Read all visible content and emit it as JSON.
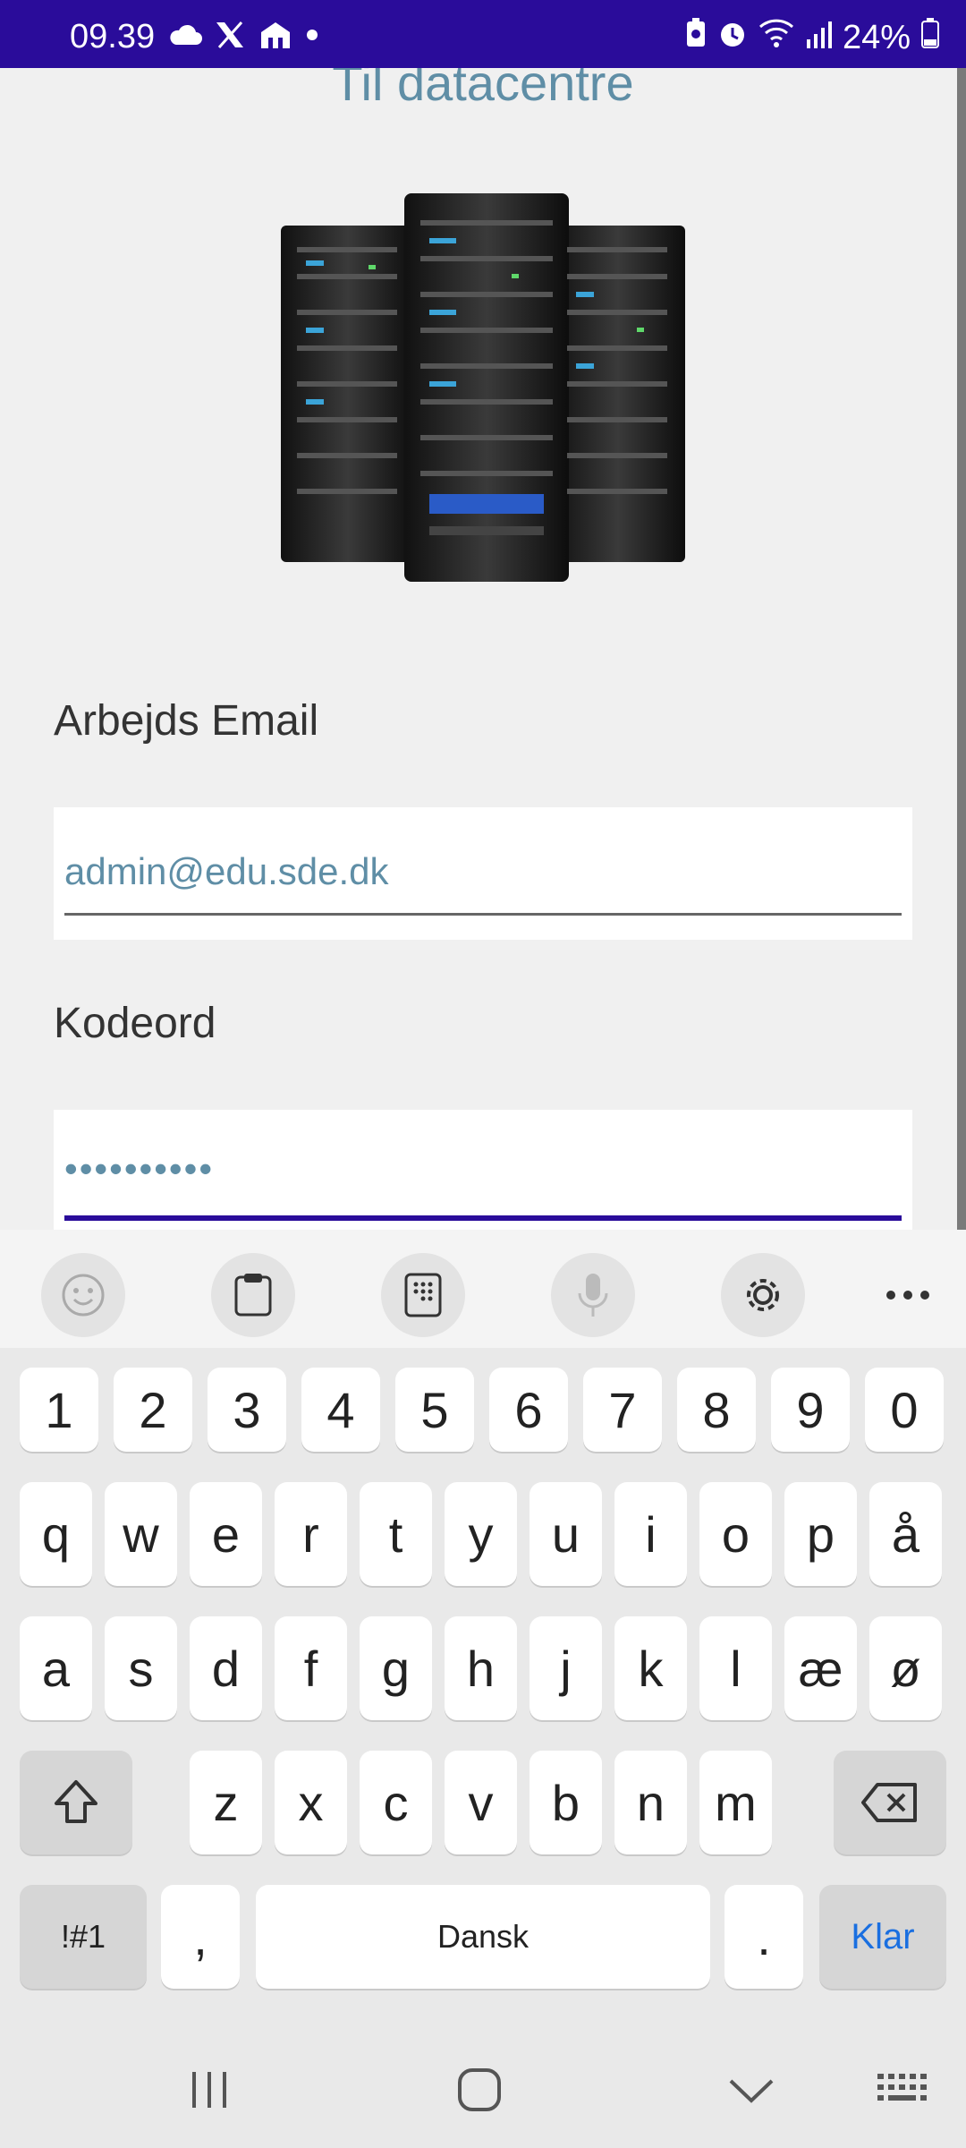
{
  "status_bar": {
    "time": "09.39",
    "battery": "24%",
    "icons_left": [
      "cloud-icon",
      "x-logo-icon",
      "food-delivery-icon",
      "dot-icon"
    ],
    "icons_right": [
      "battery-saver-icon",
      "alarm-icon",
      "wifi-icon",
      "signal-icon",
      "battery-icon"
    ]
  },
  "app": {
    "heading": "Til datacentre",
    "image": "server-racks-image",
    "email_label": "Arbejds Email",
    "email_value": "admin@edu.sde.dk",
    "password_label": "Kodeord",
    "password_value": "••••••••••"
  },
  "keyboard": {
    "toolbar": [
      "emoji-icon",
      "clipboard-icon",
      "keypad-icon",
      "microphone-icon",
      "settings-icon",
      "more-icon"
    ],
    "row_numbers": [
      "1",
      "2",
      "3",
      "4",
      "5",
      "6",
      "7",
      "8",
      "9",
      "0"
    ],
    "row1": [
      "q",
      "w",
      "e",
      "r",
      "t",
      "y",
      "u",
      "i",
      "o",
      "p",
      "å"
    ],
    "row2": [
      "a",
      "s",
      "d",
      "f",
      "g",
      "h",
      "j",
      "k",
      "l",
      "æ",
      "ø"
    ],
    "row3": [
      "z",
      "x",
      "c",
      "v",
      "b",
      "n",
      "m"
    ],
    "symbols_key": "!#1",
    "comma_key": ",",
    "space_key": "Dansk",
    "period_key": ".",
    "enter_key": "Klar"
  },
  "colors": {
    "status_bar": "#2a0c9a",
    "accent_text": "#5f8ea6",
    "focus_underline": "#2a0c9a",
    "enter_key_text": "#1a6fe0"
  }
}
